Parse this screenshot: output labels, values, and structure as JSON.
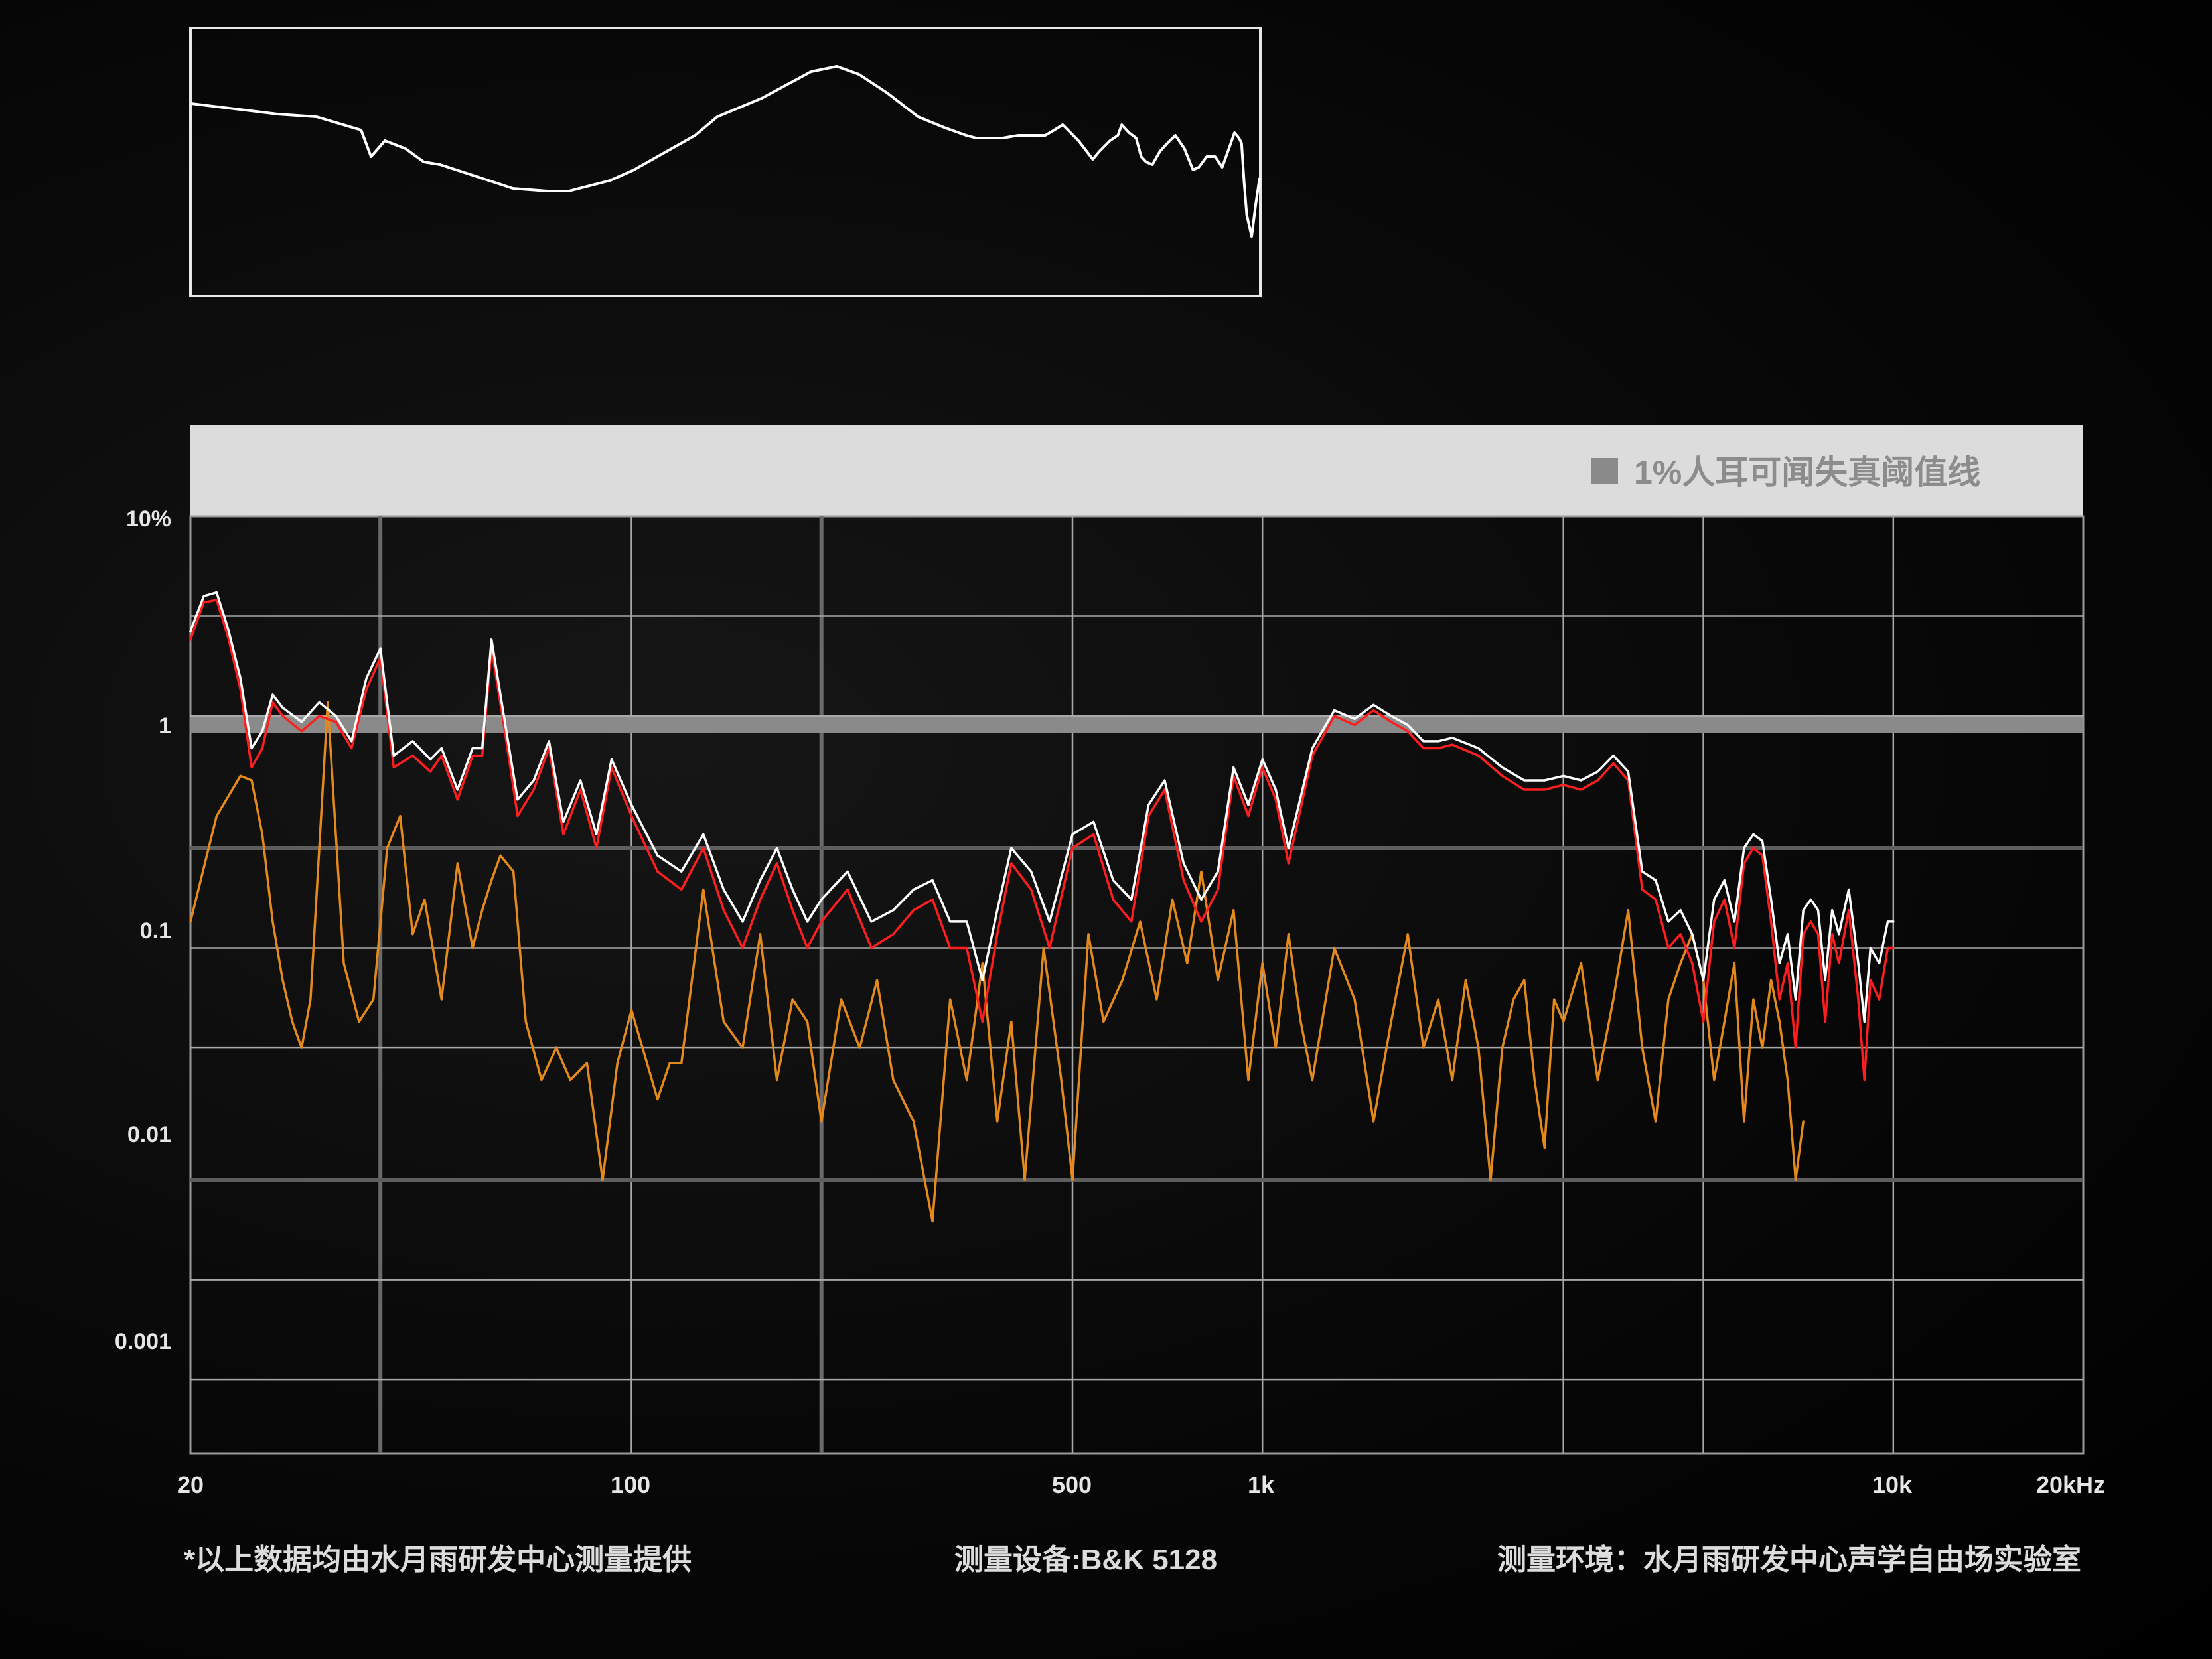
{
  "chart_data": [
    {
      "type": "line",
      "title": "",
      "xlabel": "",
      "ylabel": "",
      "grid": false,
      "legend": "none",
      "x_scale": "log",
      "xlim": [
        20,
        20000
      ],
      "ylim": [
        0,
        100
      ],
      "series": [
        {
          "name": "",
          "color": "#ffffff",
          "x": [
            20,
            35,
            45,
            60,
            64,
            70,
            80,
            90,
            100,
            130,
            160,
            200,
            230,
            300,
            350,
            420,
            520,
            600,
            800,
            1100,
            1300,
            1500,
            1800,
            2200,
            2600,
            3000,
            3200,
            3500,
            3800,
            4200,
            4600,
            5000,
            5300,
            5600,
            6200,
            6800,
            7100,
            7600,
            8000,
            8200,
            8600,
            9000,
            9300,
            9600,
            10000,
            10500,
            11000,
            11600,
            12300,
            13000,
            13500,
            14200,
            15000,
            15700,
            16400,
            17000,
            17500,
            17800,
            18100,
            18400,
            19000,
            19500,
            20000
          ],
          "values": [
            72,
            68,
            67,
            62,
            52,
            58,
            55,
            50,
            49,
            44,
            40,
            39,
            39,
            43,
            47,
            53,
            60,
            67,
            74,
            84,
            86,
            83,
            76,
            67,
            63,
            60,
            59,
            59,
            59,
            60,
            60,
            60,
            62,
            64,
            58,
            51,
            54,
            58,
            60,
            64,
            61,
            59,
            52,
            50,
            49,
            54,
            57,
            60,
            55,
            47,
            48,
            52,
            52,
            48,
            55,
            61,
            59,
            57,
            42,
            30,
            22,
            34,
            44
          ]
        }
      ]
    },
    {
      "type": "line",
      "title": "",
      "xlabel": "",
      "ylabel": "",
      "x_scale": "log",
      "y_scale": "log",
      "xlim": [
        20,
        20000
      ],
      "ylim": [
        0.0003,
        0.2
      ],
      "x_ticks": [
        "20",
        "100",
        "500",
        "1k",
        "10k",
        "20kHz"
      ],
      "x_tick_values": [
        20,
        100,
        500,
        1000,
        10000,
        20000
      ],
      "y_ticks": [
        "10%",
        "1",
        "0.1",
        "0.01",
        "0.001"
      ],
      "y_tick_values": [
        0.2,
        0.02,
        0.002,
        0.0002,
        2e-05
      ],
      "grid": true,
      "legend": "top-right",
      "threshold": {
        "label": "1%人耳可闻失真阈值线",
        "color": "#8a8a8a"
      },
      "series": [
        {
          "name": "",
          "color": "#ff1e1e",
          "x": [
            20,
            21,
            22,
            23,
            24,
            25,
            26,
            27,
            28,
            30,
            32,
            34,
            36,
            38,
            40,
            42,
            45,
            48,
            50,
            53,
            56,
            58,
            60,
            63,
            66,
            70,
            74,
            78,
            83,
            88,
            93,
            100,
            110,
            120,
            130,
            140,
            150,
            160,
            170,
            180,
            190,
            200,
            220,
            240,
            260,
            280,
            300,
            320,
            340,
            360,
            380,
            400,
            430,
            460,
            500,
            540,
            580,
            620,
            660,
            700,
            750,
            800,
            850,
            900,
            950,
            1000,
            1050,
            1100,
            1200,
            1300,
            1400,
            1500,
            1600,
            1700,
            1800,
            1900,
            2000,
            2200,
            2400,
            2600,
            2800,
            3000,
            3200,
            3400,
            3600,
            3800,
            4000,
            4200,
            4400,
            4600,
            4800,
            5000,
            5200,
            5400,
            5600,
            5800,
            6000,
            6200,
            6400,
            6600,
            6800,
            7000,
            7200,
            7400,
            7600,
            7800,
            8000,
            8200,
            8500,
            8800,
            9000,
            9200,
            9500,
            9800,
            10000
          ],
          "values": [
            0.085,
            0.11,
            0.112,
            0.085,
            0.06,
            0.035,
            0.04,
            0.055,
            0.05,
            0.045,
            0.05,
            0.048,
            0.04,
            0.06,
            0.075,
            0.035,
            0.038,
            0.034,
            0.038,
            0.028,
            0.038,
            0.038,
            0.08,
            0.045,
            0.025,
            0.03,
            0.04,
            0.022,
            0.03,
            0.02,
            0.035,
            0.025,
            0.017,
            0.015,
            0.02,
            0.013,
            0.01,
            0.014,
            0.018,
            0.013,
            0.01,
            0.012,
            0.015,
            0.01,
            0.011,
            0.013,
            0.014,
            0.01,
            0.01,
            0.006,
            0.011,
            0.018,
            0.015,
            0.01,
            0.02,
            0.022,
            0.014,
            0.012,
            0.025,
            0.03,
            0.016,
            0.012,
            0.015,
            0.033,
            0.025,
            0.035,
            0.028,
            0.018,
            0.038,
            0.05,
            0.047,
            0.052,
            0.048,
            0.045,
            0.04,
            0.04,
            0.041,
            0.038,
            0.033,
            0.03,
            0.03,
            0.031,
            0.03,
            0.032,
            0.036,
            0.032,
            0.015,
            0.014,
            0.01,
            0.011,
            0.009,
            0.006,
            0.012,
            0.014,
            0.01,
            0.018,
            0.02,
            0.019,
            0.012,
            0.007,
            0.009,
            0.005,
            0.011,
            0.012,
            0.011,
            0.006,
            0.011,
            0.009,
            0.013,
            0.007,
            0.004,
            0.008,
            0.007,
            0.01,
            0.01
          ]
        },
        {
          "name": "",
          "color": "#ffffff",
          "x": [
            20,
            21,
            22,
            23,
            24,
            25,
            26,
            27,
            28,
            30,
            32,
            34,
            36,
            38,
            40,
            42,
            45,
            48,
            50,
            53,
            56,
            58,
            60,
            63,
            66,
            70,
            74,
            78,
            83,
            88,
            93,
            100,
            110,
            120,
            130,
            140,
            150,
            160,
            170,
            180,
            190,
            200,
            220,
            240,
            260,
            280,
            300,
            320,
            340,
            360,
            380,
            400,
            430,
            460,
            500,
            540,
            580,
            620,
            660,
            700,
            750,
            800,
            850,
            900,
            950,
            1000,
            1050,
            1100,
            1200,
            1300,
            1400,
            1500,
            1600,
            1700,
            1800,
            1900,
            2000,
            2200,
            2400,
            2600,
            2800,
            3000,
            3200,
            3400,
            3600,
            3800,
            4000,
            4200,
            4400,
            4600,
            4800,
            5000,
            5200,
            5400,
            5600,
            5800,
            6000,
            6200,
            6400,
            6600,
            6800,
            7000,
            7200,
            7400,
            7600,
            7800,
            8000,
            8200,
            8500,
            8800,
            9000,
            9200,
            9500,
            9800,
            10000
          ],
          "values": [
            0.09,
            0.115,
            0.118,
            0.09,
            0.065,
            0.04,
            0.045,
            0.058,
            0.053,
            0.048,
            0.055,
            0.05,
            0.042,
            0.065,
            0.08,
            0.038,
            0.042,
            0.037,
            0.04,
            0.03,
            0.04,
            0.04,
            0.085,
            0.048,
            0.028,
            0.032,
            0.042,
            0.024,
            0.032,
            0.022,
            0.037,
            0.027,
            0.019,
            0.017,
            0.022,
            0.015,
            0.012,
            0.016,
            0.02,
            0.015,
            0.012,
            0.014,
            0.017,
            0.012,
            0.013,
            0.015,
            0.016,
            0.012,
            0.012,
            0.008,
            0.013,
            0.02,
            0.017,
            0.012,
            0.022,
            0.024,
            0.016,
            0.014,
            0.027,
            0.032,
            0.018,
            0.014,
            0.017,
            0.035,
            0.027,
            0.037,
            0.03,
            0.02,
            0.04,
            0.052,
            0.049,
            0.054,
            0.05,
            0.047,
            0.042,
            0.042,
            0.043,
            0.04,
            0.035,
            0.032,
            0.032,
            0.033,
            0.032,
            0.034,
            0.038,
            0.034,
            0.017,
            0.016,
            0.012,
            0.013,
            0.011,
            0.008,
            0.014,
            0.016,
            0.012,
            0.02,
            0.022,
            0.021,
            0.014,
            0.009,
            0.011,
            0.007,
            0.013,
            0.014,
            0.013,
            0.008,
            0.013,
            0.011,
            0.015,
            0.009,
            0.006,
            0.01,
            0.009,
            0.012,
            0.012
          ]
        },
        {
          "name": "",
          "color": "#e48a1c",
          "x": [
            20,
            22,
            24,
            25,
            26,
            27,
            28,
            29,
            30,
            31,
            33,
            35,
            37,
            39,
            41,
            43,
            45,
            47,
            50,
            53,
            56,
            58,
            60,
            62,
            65,
            68,
            72,
            76,
            80,
            85,
            90,
            95,
            100,
            110,
            115,
            120,
            130,
            140,
            150,
            160,
            170,
            180,
            190,
            200,
            215,
            230,
            245,
            260,
            280,
            300,
            320,
            340,
            360,
            380,
            400,
            420,
            450,
            480,
            500,
            530,
            560,
            600,
            640,
            680,
            720,
            760,
            800,
            850,
            900,
            950,
            1000,
            1050,
            1100,
            1150,
            1200,
            1300,
            1400,
            1500,
            1600,
            1700,
            1800,
            1900,
            2000,
            2100,
            2200,
            2300,
            2400,
            2500,
            2600,
            2700,
            2800,
            2900,
            3000,
            3200,
            3400,
            3600,
            3800,
            4000,
            4200,
            4400,
            4600,
            4800,
            5000,
            5200,
            5400,
            5600,
            5800,
            6000,
            6200,
            6400,
            6600,
            6800,
            7000,
            7200
          ],
          "values": [
            0.012,
            0.025,
            0.033,
            0.032,
            0.022,
            0.012,
            0.008,
            0.006,
            0.005,
            0.007,
            0.055,
            0.009,
            0.006,
            0.007,
            0.02,
            0.025,
            0.011,
            0.014,
            0.007,
            0.018,
            0.01,
            0.013,
            0.016,
            0.019,
            0.017,
            0.006,
            0.004,
            0.005,
            0.004,
            0.0045,
            0.002,
            0.0045,
            0.0065,
            0.0035,
            0.0045,
            0.0045,
            0.015,
            0.006,
            0.005,
            0.011,
            0.004,
            0.007,
            0.006,
            0.003,
            0.007,
            0.005,
            0.008,
            0.004,
            0.003,
            0.0015,
            0.007,
            0.004,
            0.009,
            0.003,
            0.006,
            0.002,
            0.01,
            0.004,
            0.002,
            0.011,
            0.006,
            0.008,
            0.012,
            0.007,
            0.014,
            0.009,
            0.017,
            0.008,
            0.013,
            0.004,
            0.009,
            0.005,
            0.011,
            0.006,
            0.004,
            0.01,
            0.007,
            0.003,
            0.006,
            0.011,
            0.005,
            0.007,
            0.004,
            0.008,
            0.005,
            0.002,
            0.005,
            0.007,
            0.008,
            0.004,
            0.0025,
            0.007,
            0.006,
            0.009,
            0.004,
            0.007,
            0.013,
            0.005,
            0.003,
            0.007,
            0.009,
            0.011,
            0.008,
            0.004,
            0.006,
            0.009,
            0.003,
            0.007,
            0.005,
            0.008,
            0.006,
            0.004,
            0.002,
            0.003
          ]
        }
      ]
    }
  ],
  "footer": {
    "source_note": "*以上数据均由水月雨研发中心测量提供",
    "equipment": "测量设备:B&K 5128",
    "environment": "测量环境：水月雨研发中心声学自由场实验室"
  }
}
